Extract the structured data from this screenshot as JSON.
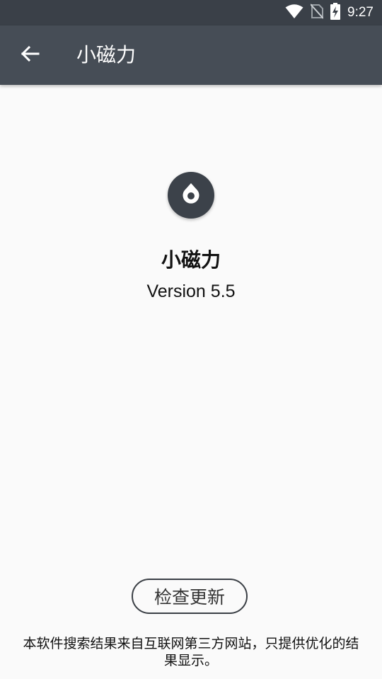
{
  "status_bar": {
    "time": "9:27",
    "icons": [
      "wifi-icon",
      "no-sim-icon",
      "battery-charging-icon"
    ]
  },
  "toolbar": {
    "back_icon": "arrow-back-icon",
    "title": "小磁力"
  },
  "about": {
    "app_icon": "magnet-drop-icon",
    "app_name": "小磁力",
    "version": "Version 5.5",
    "check_update_label": "检查更新",
    "disclaimer": "本软件搜索结果来自互联网第三方网站，只提供优化的结果显示。"
  },
  "colors": {
    "status_bar_bg": "#3a4048",
    "toolbar_bg": "#464d56",
    "page_bg": "#fafafa",
    "icon_bg": "#3c424a"
  }
}
